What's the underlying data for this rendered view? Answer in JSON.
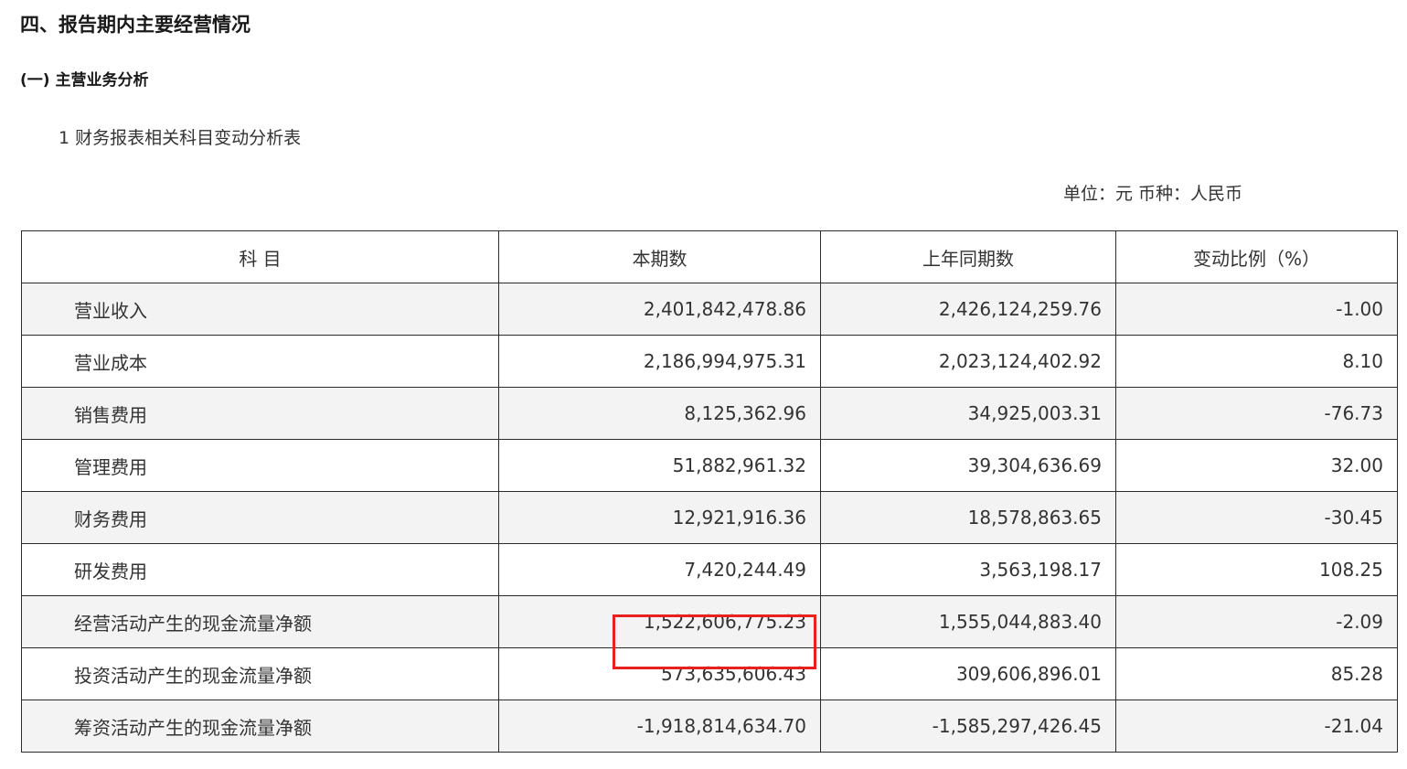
{
  "section_title": "四、报告期内主要经营情况",
  "subsection_title": "(一) 主营业务分析",
  "table_caption": "1 财务报表相关科目变动分析表",
  "unit_note": "单位：元  币种：人民币",
  "highlight_color": "#e8201e",
  "table": {
    "headers": [
      "科  目",
      "本期数",
      "上年同期数",
      "变动比例（%）"
    ],
    "rows": [
      {
        "item": "营业收入",
        "current": "2,401,842,478.86",
        "prior": "2,426,124,259.76",
        "change": "-1.00"
      },
      {
        "item": "营业成本",
        "current": "2,186,994,975.31",
        "prior": "2,023,124,402.92",
        "change": "8.10"
      },
      {
        "item": "销售费用",
        "current": "8,125,362.96",
        "prior": "34,925,003.31",
        "change": "-76.73"
      },
      {
        "item": "管理费用",
        "current": "51,882,961.32",
        "prior": "39,304,636.69",
        "change": "32.00"
      },
      {
        "item": "财务费用",
        "current": "12,921,916.36",
        "prior": "18,578,863.65",
        "change": "-30.45"
      },
      {
        "item": "研发费用",
        "current": "7,420,244.49",
        "prior": "3,563,198.17",
        "change": "108.25"
      },
      {
        "item": "经营活动产生的现金流量净额",
        "current": "1,522,606,775.23",
        "prior": "1,555,044,883.40",
        "change": "-2.09"
      },
      {
        "item": "投资活动产生的现金流量净额",
        "current": "573,635,606.43",
        "prior": "309,606,896.01",
        "change": "85.28"
      },
      {
        "item": "筹资活动产生的现金流量净额",
        "current": "-1,918,814,634.70",
        "prior": "-1,585,297,426.45",
        "change": "-21.04"
      }
    ]
  }
}
